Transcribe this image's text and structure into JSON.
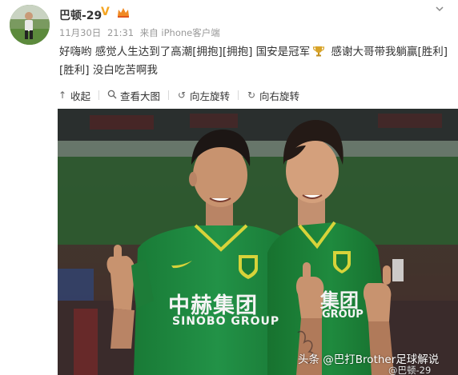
{
  "user": {
    "name": "巴顿-29",
    "verified_mark": "V"
  },
  "meta": {
    "date": "11月30日",
    "time": "21:31",
    "source": "来自 iPhone客户端"
  },
  "post": {
    "text_before_icon": "好嗨哟 感觉人生达到了高潮[拥抱][拥抱]  国安是冠军",
    "text_after_icon": " 感谢大哥带我躺赢[胜利][胜利] 没白吃苦啊我"
  },
  "toolbar": {
    "items": [
      {
        "label": "收起",
        "icon": "collapse-up-arrow-icon"
      },
      {
        "label": "查看大图",
        "icon": "magnifier-icon"
      },
      {
        "label": "向左旋转",
        "icon": "rotate-left-icon"
      },
      {
        "label": "向右旋转",
        "icon": "rotate-right-icon"
      }
    ]
  },
  "photo": {
    "jersey_sponsor_cn": "中赫集团",
    "jersey_sponsor_en": "SINOBO GROUP",
    "jersey_sponsor_cn_partial": "集团",
    "jersey_sponsor_en_partial": "GROUP",
    "watermark_toutiao": "头条 @巴打Brother足球解说",
    "watermark_weibo": "@巴顿-29"
  },
  "colors": {
    "jersey_green": "#1f8a3e",
    "verified_gold": "#f5a623",
    "meta_gray": "#999999"
  }
}
